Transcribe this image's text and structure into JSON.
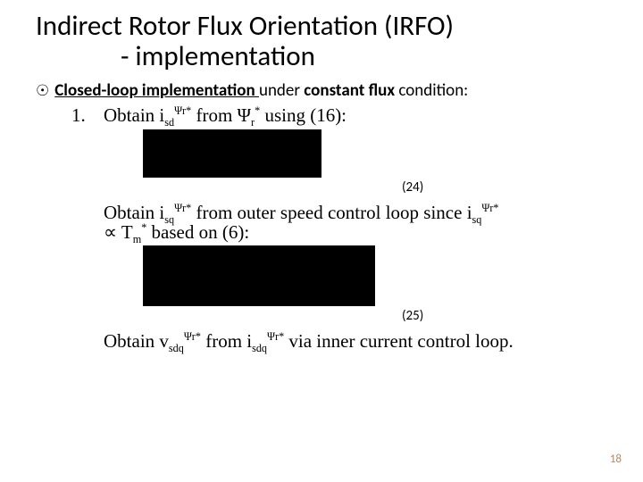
{
  "title": {
    "line1": "Indirect Rotor Flux Orientation (IRFO)",
    "line2": "- implementation"
  },
  "bullet": {
    "prefix_ul": "Closed-loop implementation ",
    "mid": "under ",
    "bold": "constant flux",
    "suffix": " condition:"
  },
  "step1": {
    "num": "1.",
    "a": "Obtain i",
    "a_sub": "sd",
    "a_sup": "Ψr*",
    "b": " from ",
    "b_psi": "Ψ",
    "b_sub": "r",
    "b_sup": "*",
    "c": " using (16):"
  },
  "eq24": "(24)",
  "para2": {
    "a": "Obtain i",
    "a_sub": "sq",
    "a_sup": "Ψr*",
    "b": " from outer speed control loop since i",
    "b_sub": "sq",
    "b_sup": "Ψr*",
    "c": " ",
    "prop": "∝",
    "d": " T",
    "d_sub": "m",
    "d_sup": "*",
    "e": "   based on (6):"
  },
  "eq25": "(25)",
  "para3": {
    "a": "Obtain v",
    "a_sub": "sdq",
    "a_sup": "Ψr*",
    "b": " from i",
    "b_sub": "sdq",
    "b_sup": "Ψr*",
    "c": " via inner current control loop."
  },
  "page": "18"
}
